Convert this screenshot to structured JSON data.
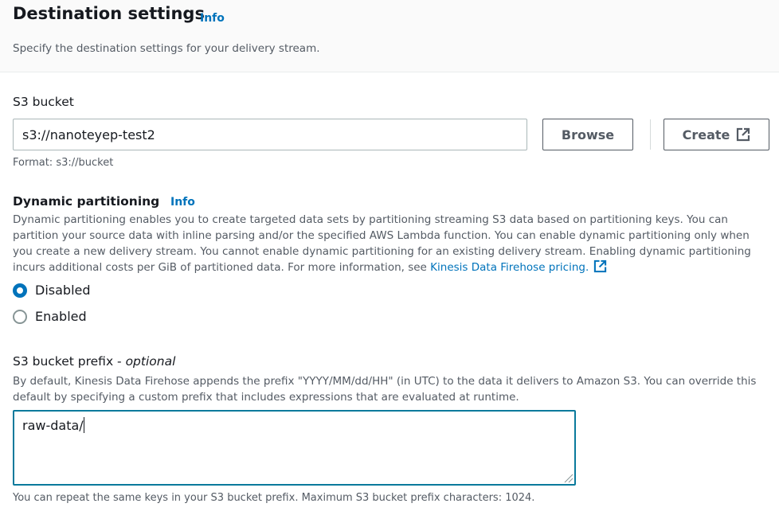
{
  "header": {
    "title": "Destination settings",
    "info_label": "Info",
    "description": "Specify the destination settings for your delivery stream."
  },
  "s3_bucket": {
    "label": "S3 bucket",
    "value": "s3://nanoteyep-test2",
    "browse_label": "Browse",
    "create_label": "Create",
    "create_icon": "external-link-icon",
    "format_hint": "Format: s3://bucket"
  },
  "dynamic_partitioning": {
    "label": "Dynamic partitioning",
    "info_label": "Info",
    "description_lines": [
      "Dynamic partitioning enables you to create targeted data sets by partitioning streaming S3 data based on partitioning keys. You can",
      "partition your source data with inline parsing and/or the specified AWS Lambda function. You can enable dynamic partitioning only when",
      "you create a new delivery stream. You cannot enable dynamic partitioning for an existing delivery stream. Enabling dynamic partitioning",
      "incurs additional costs per GiB of partitioned data. For more information, see "
    ],
    "pricing_link": "Kinesis Data Firehose pricing.",
    "options": [
      {
        "label": "Disabled",
        "selected": true
      },
      {
        "label": "Enabled",
        "selected": false
      }
    ]
  },
  "prefix": {
    "label": "S3 bucket prefix - ",
    "label_optional": "optional",
    "description_lines": [
      "By default, Kinesis Data Firehose appends the prefix \"YYYY/MM/dd/HH\" (in UTC) to the data it delivers to Amazon S3. You can override this",
      "default by specifying a custom prefix that includes expressions that are evaluated at runtime."
    ],
    "value": "raw-data/",
    "hint": "You can repeat the same keys in your S3 bucket prefix. Maximum S3 bucket prefix characters: 1024."
  },
  "colors": {
    "link": "#0073bb",
    "radio_selected": "#0073bb",
    "focus_border": "#0a7a9c"
  }
}
